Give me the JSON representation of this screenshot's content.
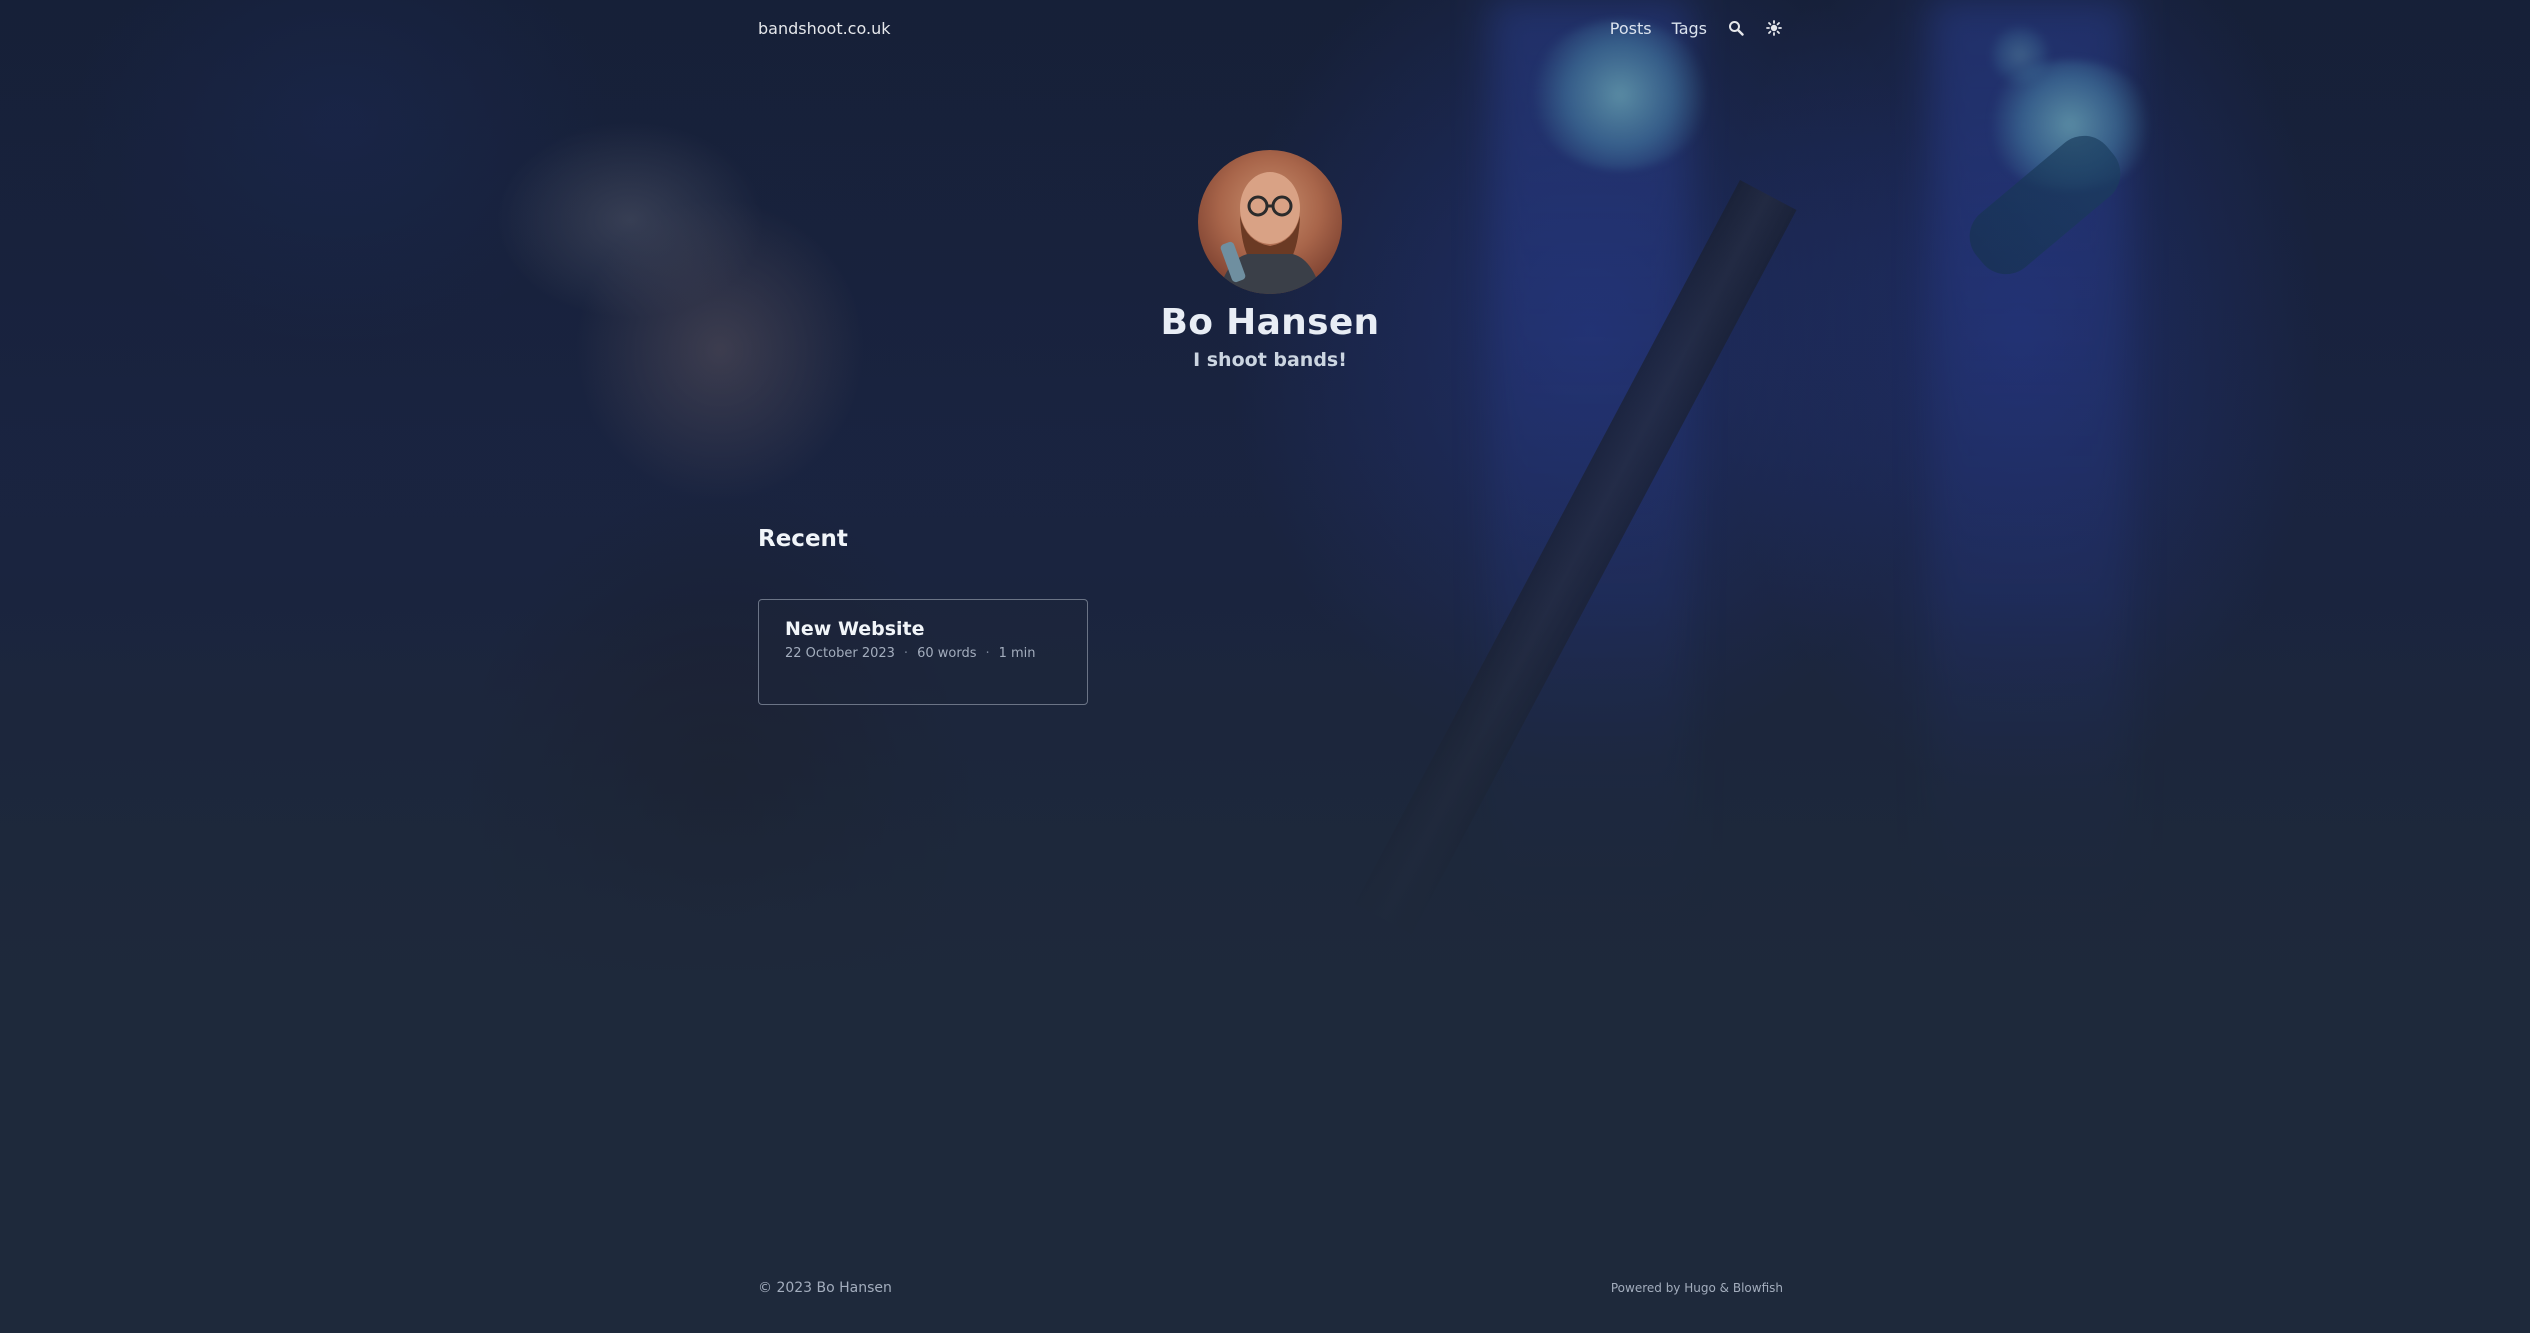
{
  "header": {
    "site_title": "bandshoot.co.uk",
    "nav": [
      {
        "label": "Posts"
      },
      {
        "label": "Tags"
      }
    ],
    "icons": {
      "search": "search-icon",
      "appearance": "sun-icon"
    }
  },
  "profile": {
    "name": "Bo Hansen",
    "tagline": "I shoot bands!"
  },
  "recent": {
    "heading": "Recent",
    "posts": [
      {
        "title": "New Website",
        "date": "22 October 2023",
        "words": "60 words",
        "reading_time": "1 min",
        "separator": "·"
      }
    ]
  },
  "footer": {
    "copyright": "© 2023 Bo Hansen",
    "powered_prefix": "Powered by",
    "powered_hugo": "Hugo",
    "powered_amp": "&",
    "powered_theme": "Blowfish"
  },
  "colors": {
    "background": "#1e293b",
    "text": "#e2e8f0",
    "muted": "#a3adbd",
    "card_border": "#6b7486"
  }
}
